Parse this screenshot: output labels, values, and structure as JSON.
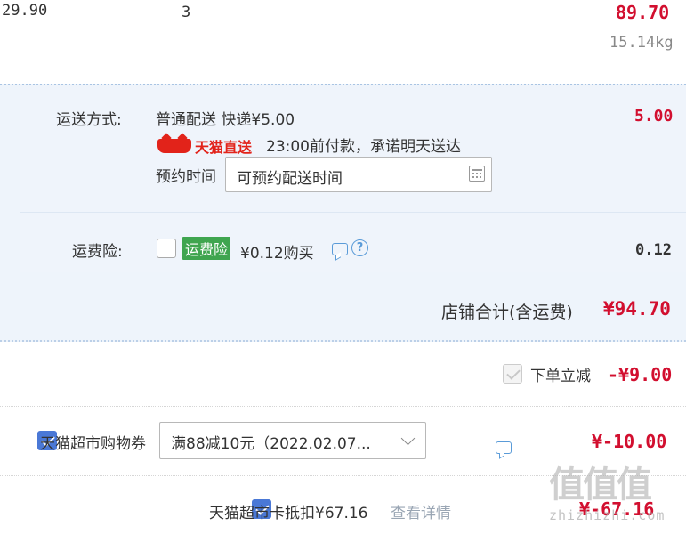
{
  "item": {
    "unit_price": "29.90",
    "quantity": "3",
    "subtotal": "89.70",
    "weight": "15.14kg"
  },
  "delivery": {
    "label": "运送方式:",
    "method": "普通配送 快递¥5.00",
    "fee": "5.00",
    "tmall_brand": "天猫直送",
    "promise": "23:00前付款，承诺明天送达",
    "appointment_label": "预约时间",
    "appointment_placeholder": "可预约配送时间"
  },
  "insurance": {
    "label": "运费险:",
    "badge": "运费险",
    "price_text": "¥0.12购买",
    "fee": "0.12"
  },
  "store_total": {
    "label": "店铺合计(含运费)",
    "value": "¥94.70"
  },
  "order_discount": {
    "label": "下单立减",
    "value": "-¥9.00"
  },
  "coupon": {
    "label": "天猫超市购物券",
    "selected": "满88减10元（2022.02.07...",
    "value": "¥-10.00"
  },
  "card": {
    "label": "天猫超市卡抵扣¥67.16",
    "link": "查看详情",
    "value": "¥-67.16"
  },
  "watermark": {
    "text": "值值值",
    "url": "zhizhizhi.com"
  },
  "colors": {
    "price_red": "#d20f2f",
    "accent_blue": "#4a78d6",
    "panel_bg": "#eef4fb",
    "badge_green": "#3fa54f"
  }
}
